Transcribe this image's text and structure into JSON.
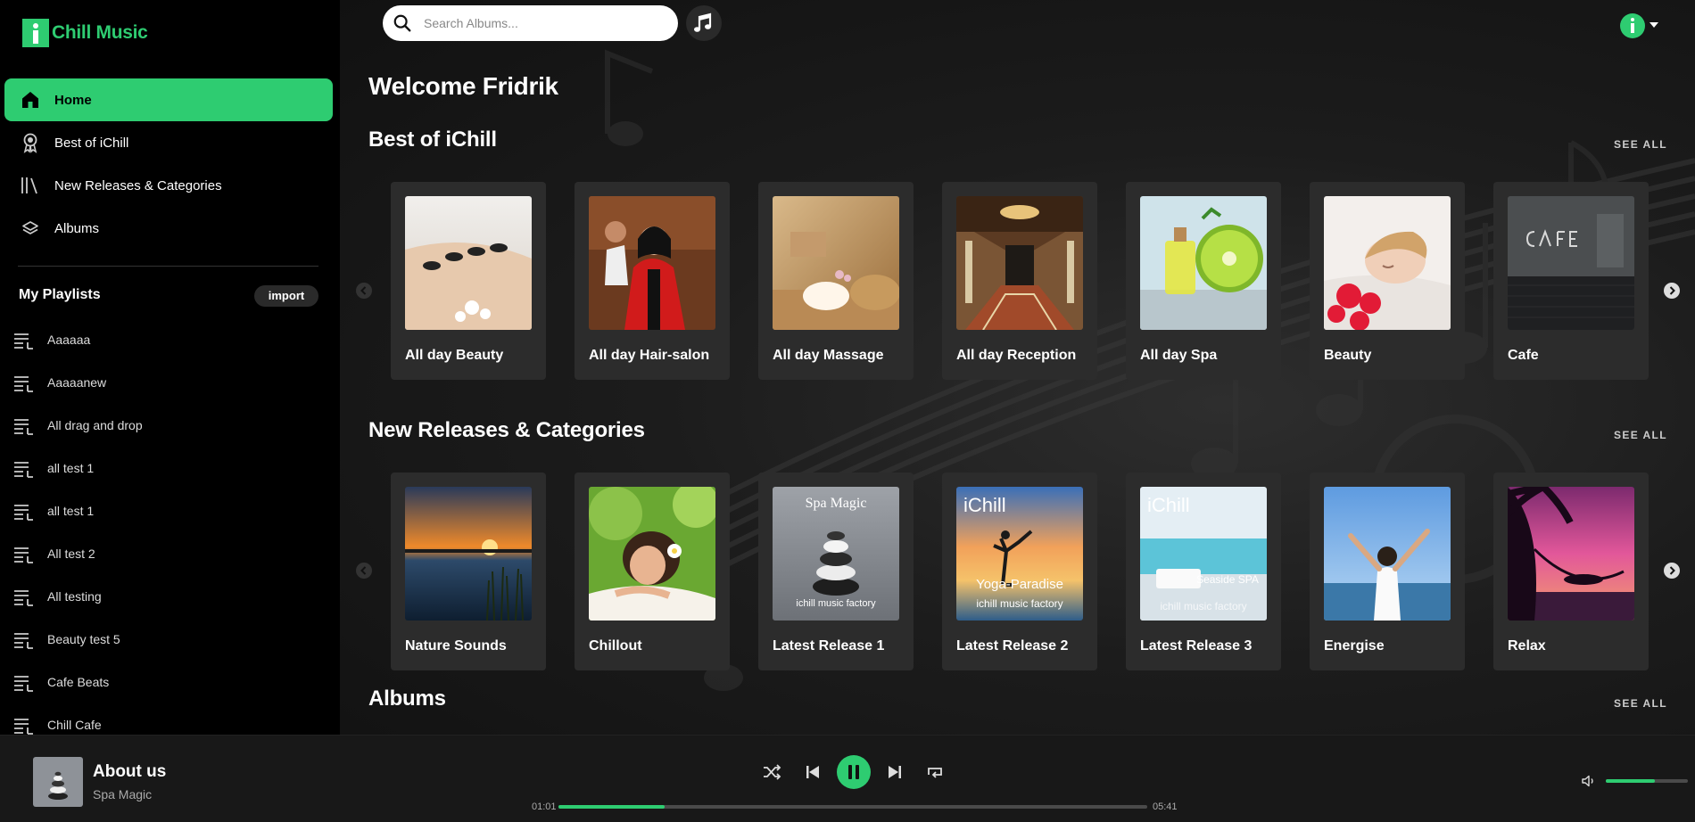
{
  "app": {
    "name": "Chill Music",
    "accent": "#2ecc71"
  },
  "nav": [
    {
      "label": "Home",
      "icon": "home-icon",
      "active": true
    },
    {
      "label": "Best of iChill",
      "icon": "award-icon",
      "active": false
    },
    {
      "label": "New Releases & Categories",
      "icon": "library-icon",
      "active": false
    },
    {
      "label": "Albums",
      "icon": "layers-icon",
      "active": false
    }
  ],
  "playlists": {
    "title": "My Playlists",
    "import_label": "import",
    "items": [
      "Aaaaaa",
      "Aaaaanew",
      "All drag and drop",
      "all test 1",
      "all test 1",
      "All test 2",
      "All testing",
      "Beauty test 5",
      "Cafe Beats",
      "Chill Cafe"
    ]
  },
  "search": {
    "placeholder": "Search Albums..."
  },
  "welcome": "Welcome Fridrik",
  "sections": [
    {
      "title": "Best of iChill",
      "see_all": "SEE ALL",
      "cards": [
        {
          "title": "All day Beauty"
        },
        {
          "title": "All day Hair-salon"
        },
        {
          "title": "All day Massage"
        },
        {
          "title": "All day Reception"
        },
        {
          "title": "All day Spa"
        },
        {
          "title": "Beauty"
        },
        {
          "title": "Cafe"
        }
      ]
    },
    {
      "title": "New Releases & Categories",
      "see_all": "SEE ALL",
      "cards": [
        {
          "title": "Nature Sounds"
        },
        {
          "title": "Chillout"
        },
        {
          "title": "Latest Release 1",
          "art_text": [
            "Spa Magic",
            "ichill music factory"
          ]
        },
        {
          "title": "Latest Release 2",
          "art_text": [
            "iChill",
            "Yoga-Paradise",
            "ichill music factory"
          ]
        },
        {
          "title": "Latest Release 3",
          "art_text": [
            "iChill",
            "Seaside SPA",
            "ichill music factory"
          ]
        },
        {
          "title": "Energise"
        },
        {
          "title": "Relax"
        }
      ]
    },
    {
      "title": "Albums",
      "see_all": "SEE ALL"
    }
  ],
  "player": {
    "title": "About us",
    "artist": "Spa Magic",
    "current_time": "01:01",
    "total_time": "05:41",
    "progress": 0.18,
    "volume": 0.6,
    "state": "playing"
  }
}
